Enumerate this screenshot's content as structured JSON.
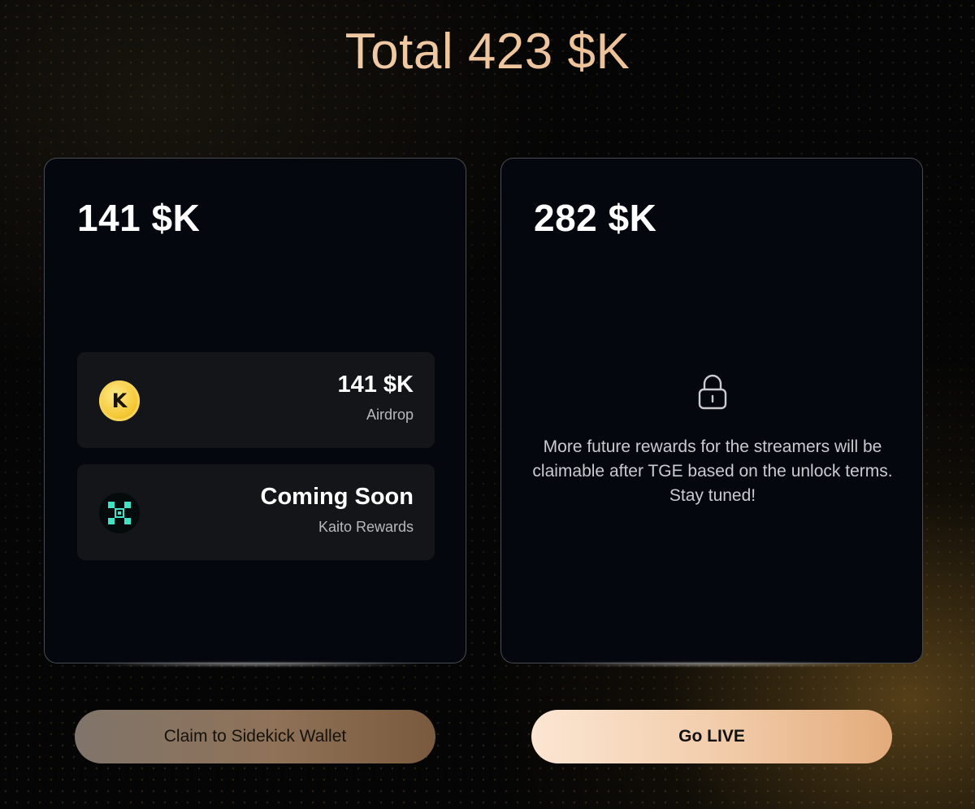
{
  "header": {
    "title": "Total 423 $K"
  },
  "left_card": {
    "amount": "141 $K",
    "rewards": [
      {
        "icon": "k-token-icon",
        "value": "141 $K",
        "label": "Airdrop"
      },
      {
        "icon": "kaito-icon",
        "value": "Coming Soon",
        "label": "Kaito Rewards"
      }
    ]
  },
  "right_card": {
    "amount": "282 $K",
    "icon": "lock-icon",
    "message": "More future rewards for the streamers will be claimable after TGE based on the unlock terms. Stay tuned!"
  },
  "actions": {
    "claim_label": "Claim to Sidekick Wallet",
    "live_label": "Go LIVE"
  },
  "colors": {
    "title_gold": "#f1c7a0",
    "card_bg": "#04070d",
    "item_bg": "#131519",
    "kaito_teal": "#3fe3c8",
    "k_token_yellow": "#f5c936"
  }
}
